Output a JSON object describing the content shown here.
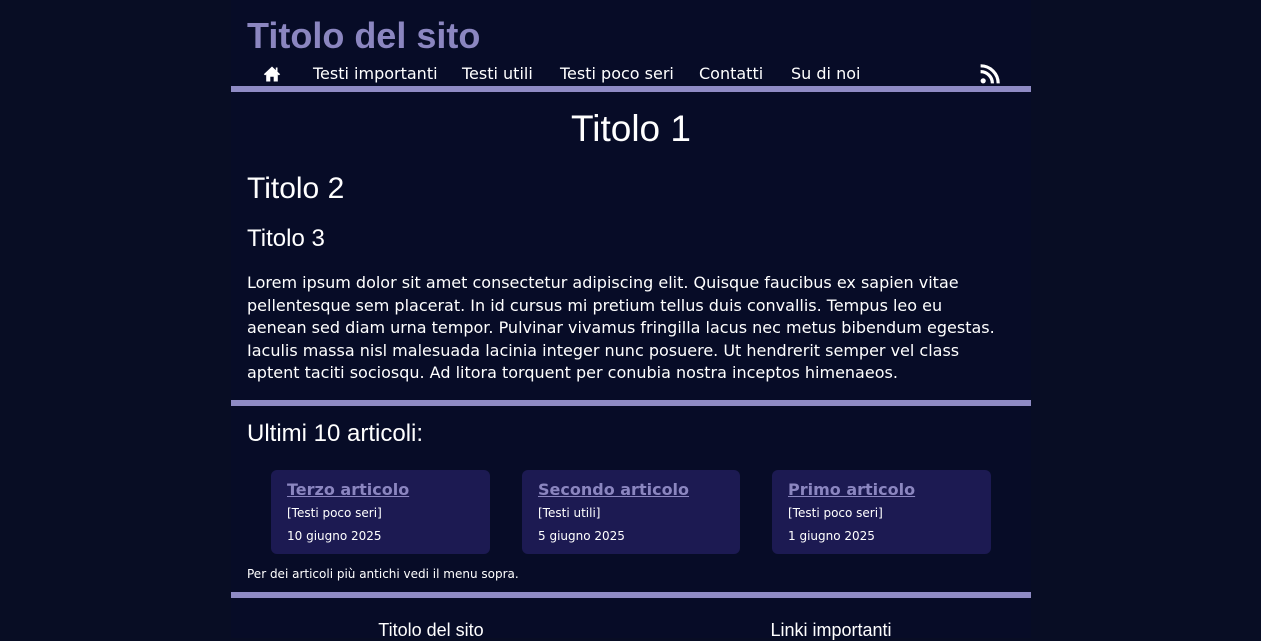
{
  "colors": {
    "background": "#080d24",
    "content_background": "#070c27",
    "accent": "#8b86c0",
    "rule": "#8f8bc5",
    "card_background": "#1c1a52",
    "text": "#ffffff"
  },
  "header": {
    "site_title": "Titolo del sito"
  },
  "nav": {
    "home_icon": "home-icon",
    "rss_icon": "rss-icon",
    "items": [
      {
        "label": "Testi importanti"
      },
      {
        "label": "Testi utili"
      },
      {
        "label": "Testi poco seri"
      },
      {
        "label": "Contatti"
      },
      {
        "label": "Su di noi"
      }
    ]
  },
  "main": {
    "h1": "Titolo 1",
    "h2": "Titolo 2",
    "h3": "Titolo 3",
    "paragraph": "Lorem ipsum dolor sit amet consectetur adipiscing elit. Quisque faucibus ex sapien vitae pellentesque sem placerat. In id cursus mi pretium tellus duis convallis. Tempus leo eu aenean sed diam urna tempor. Pulvinar vivamus fringilla lacus nec metus bibendum egestas. Iaculis massa nisl malesuada lacinia integer nunc posuere. Ut hendrerit semper vel class aptent taciti sociosqu. Ad litora torquent per conubia nostra inceptos himenaeos."
  },
  "articles": {
    "heading": "Ultimi 10 articoli:",
    "items": [
      {
        "title": "Terzo articolo",
        "category": "[Testi poco seri]",
        "date": "10 giugno 2025"
      },
      {
        "title": "Secondo articolo",
        "category": "[Testi utili]",
        "date": "5 giugno 2025"
      },
      {
        "title": "Primo articolo",
        "category": "[Testi poco seri]",
        "date": "1 giugno 2025"
      }
    ],
    "older_note": "Per dei articoli più antichi vedi il menu sopra."
  },
  "footer": {
    "col1_title": "Titolo del sito",
    "col2_title": "Linki importanti"
  }
}
